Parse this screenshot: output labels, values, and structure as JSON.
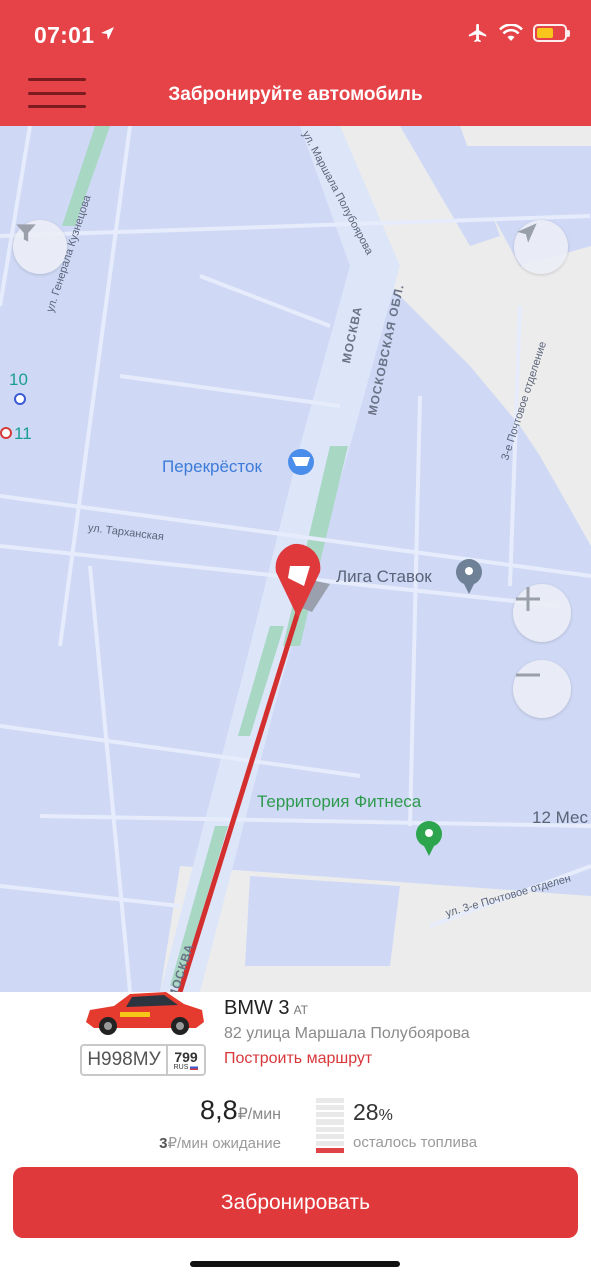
{
  "status_bar": {
    "time": "07:01",
    "battery_level": 0.6,
    "battery_color": "#F8C51C",
    "icons": [
      "location-arrow-icon",
      "airplane-icon",
      "wifi-icon",
      "battery-icon"
    ]
  },
  "header": {
    "title": "Забронируйте автомобиль",
    "background": "#E54347"
  },
  "map": {
    "labels": {
      "poi_1": "Перекрёсток",
      "poi_2": "Лига Ставок",
      "poi_3": "Территория Фитнеса",
      "poi_4": "12 Мес",
      "metro_10": "10",
      "metro_11": "11",
      "street_1": "ул. Генерала Кузнецова",
      "street_2": "ул. Маршала Полубоярова",
      "street_3": "ул. Тарханская",
      "street_4": "ул. 3-е Почтовое отделение",
      "street_5": "ул. 3-е Почтовое отделен",
      "road_1": "МОСКВА",
      "road_2": "МОСКОВСКАЯ ОБЛ.",
      "road_3": "МОСКВА",
      "street_6": "3-е Почтовое отделение"
    }
  },
  "car": {
    "model": "BMW 3",
    "transmission": "AT",
    "address": "82 улица Маршала Полубоярова",
    "route_link": "Построить маршрут",
    "plate_number": "Н998МУ",
    "plate_region": "799",
    "plate_country": "RUS"
  },
  "pricing": {
    "price_value": "8,8",
    "price_unit": "₽/мин",
    "wait_value": "3",
    "wait_unit": "₽/мин ожидание",
    "fuel_percent": "28",
    "fuel_percent_sign": "%",
    "fuel_label": "осталось топлива",
    "fuel_level": 0.28
  },
  "actions": {
    "book_label": "Забронировать"
  },
  "colors": {
    "accent": "#E0393C",
    "map_bg": "#CFD9F5",
    "route": "#D32F2F"
  }
}
